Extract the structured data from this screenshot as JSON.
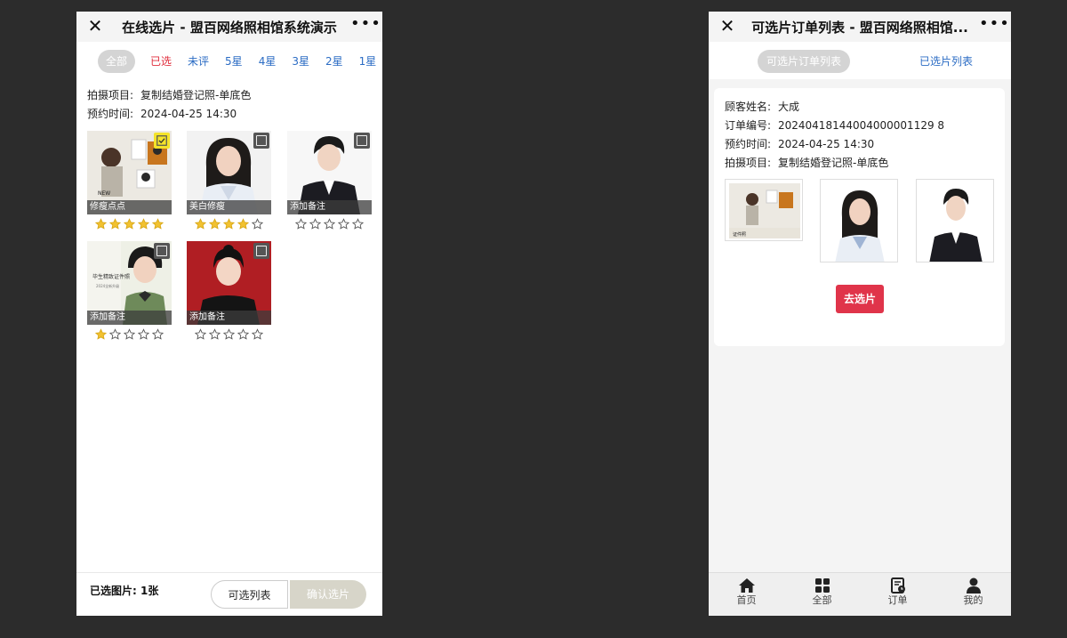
{
  "left": {
    "title": "在线选片 - 盟百网络照相馆系统演示",
    "filters": [
      "全部",
      "已选",
      "未评",
      "5星",
      "4星",
      "3星",
      "2星",
      "1星"
    ],
    "info": [
      {
        "key": "拍摄项目:",
        "value": "复制结婚登记照-单底色"
      },
      {
        "key": "预约时间:",
        "value": "2024-04-25 14:30"
      }
    ],
    "photos": [
      {
        "note": "修瘦点点",
        "stars": 5,
        "checked": true
      },
      {
        "note": "美白修瘦",
        "stars": 4,
        "checked": false
      },
      {
        "note": "添加备注",
        "stars": 0,
        "checked": false
      },
      {
        "note": "添加备注",
        "stars": 1,
        "checked": false
      },
      {
        "note": "添加备注",
        "stars": 0,
        "checked": false
      }
    ],
    "selected_count": "已选图片:  1张",
    "btn_list": "可选列表",
    "btn_confirm": "确认选片"
  },
  "right": {
    "title": "可选片订单列表 - 盟百网络照相馆...",
    "tab_active": "可选片订单列表",
    "tab_other": "已选片列表",
    "order": [
      {
        "key": "顾客姓名:",
        "value": "大成"
      },
      {
        "key": "订单编号:",
        "value": "20240418144004000001129 8"
      },
      {
        "key": "预约时间:",
        "value": "2024-04-25 14:30"
      },
      {
        "key": "拍摄项目:",
        "value": "复制结婚登记照-单底色"
      }
    ],
    "go_button": "去选片",
    "tabbar": [
      {
        "label": "首页",
        "icon": "home-icon"
      },
      {
        "label": "全部",
        "icon": "grid-icon"
      },
      {
        "label": "订单",
        "icon": "order-icon"
      },
      {
        "label": "我的",
        "icon": "user-icon"
      }
    ]
  },
  "colors": {
    "accent_blue": "#2b6cc4",
    "accent_red": "#e02d3c",
    "star": "#f2c230",
    "check": "#f4e32a"
  }
}
